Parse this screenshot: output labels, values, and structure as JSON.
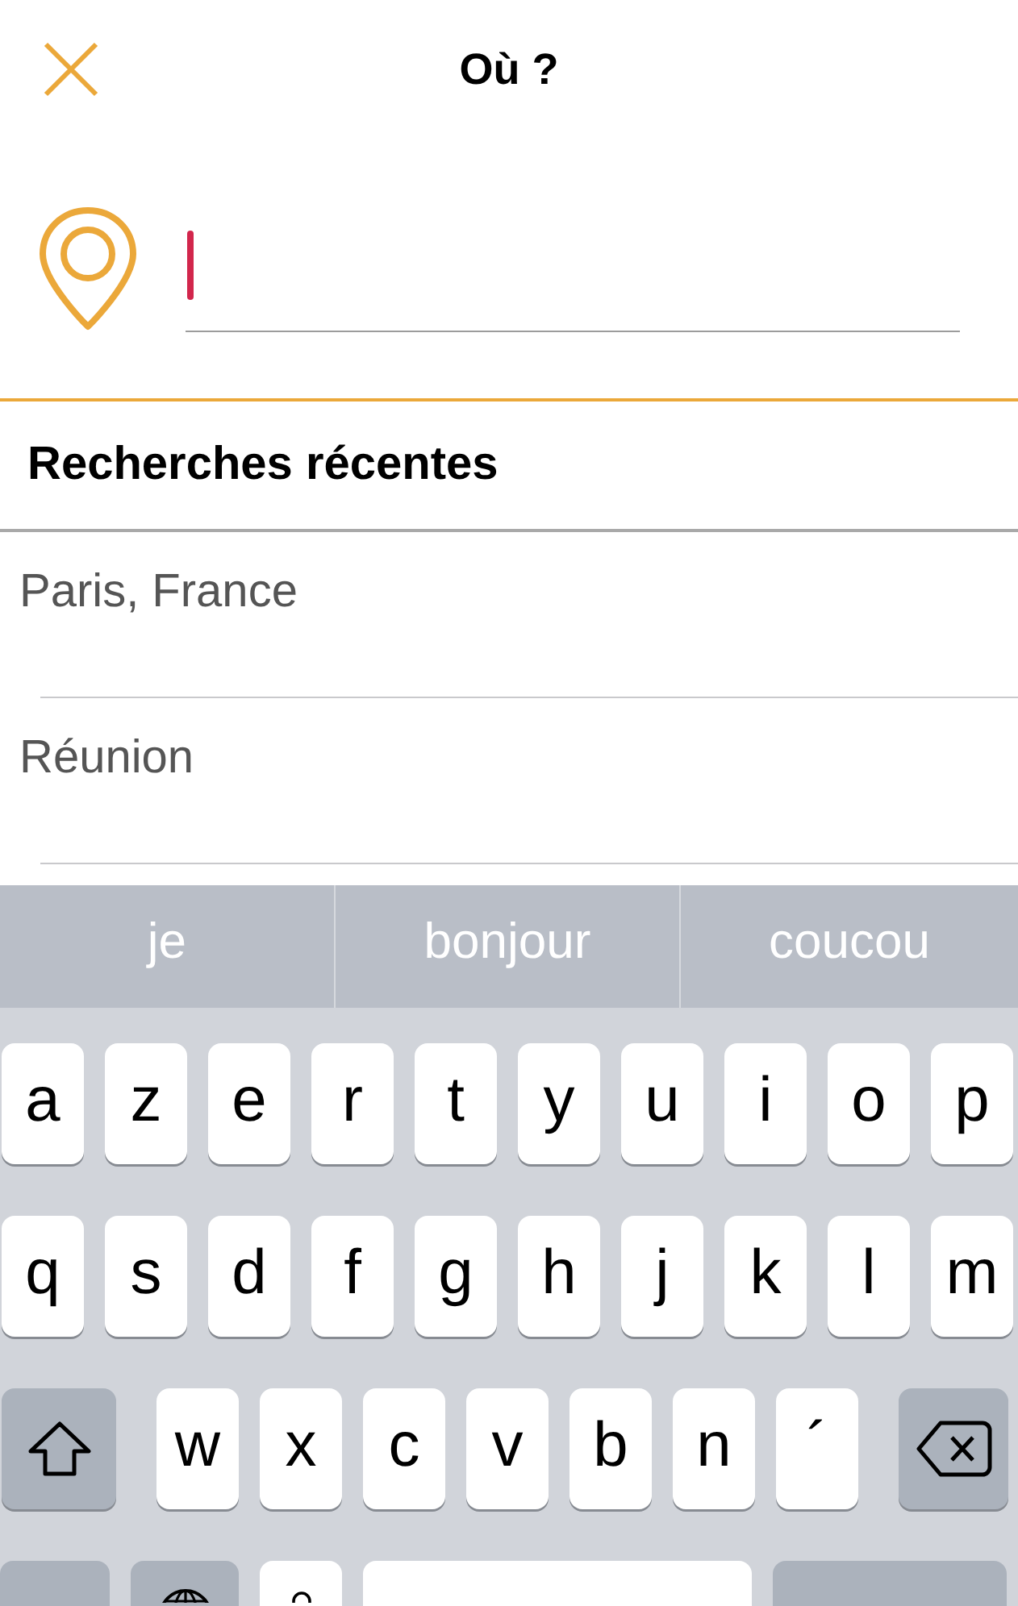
{
  "header": {
    "title": "Où ?"
  },
  "search": {
    "focused": true
  },
  "recent": {
    "heading": "Recherches récentes",
    "items": [
      "Paris, France",
      "Réunion"
    ]
  },
  "keyboard": {
    "suggestions": [
      "je",
      "bonjour",
      "coucou"
    ],
    "rows": [
      [
        {
          "kind": "letter",
          "label": "a"
        },
        {
          "kind": "letter",
          "label": "z"
        },
        {
          "kind": "letter",
          "label": "e"
        },
        {
          "kind": "letter",
          "label": "r"
        },
        {
          "kind": "letter",
          "label": "t"
        },
        {
          "kind": "letter",
          "label": "y"
        },
        {
          "kind": "letter",
          "label": "u"
        },
        {
          "kind": "letter",
          "label": "i"
        },
        {
          "kind": "letter",
          "label": "o"
        },
        {
          "kind": "letter",
          "label": "p"
        }
      ],
      [
        {
          "kind": "letter",
          "label": "q"
        },
        {
          "kind": "letter",
          "label": "s"
        },
        {
          "kind": "letter",
          "label": "d"
        },
        {
          "kind": "letter",
          "label": "f"
        },
        {
          "kind": "letter",
          "label": "g"
        },
        {
          "kind": "letter",
          "label": "h"
        },
        {
          "kind": "letter",
          "label": "j"
        },
        {
          "kind": "letter",
          "label": "k"
        },
        {
          "kind": "letter",
          "label": "l"
        },
        {
          "kind": "letter",
          "label": "m"
        }
      ],
      [
        {
          "kind": "shift"
        },
        {
          "kind": "letter",
          "label": "w"
        },
        {
          "kind": "letter",
          "label": "x"
        },
        {
          "kind": "letter",
          "label": "c"
        },
        {
          "kind": "letter",
          "label": "v"
        },
        {
          "kind": "letter",
          "label": "b"
        },
        {
          "kind": "letter",
          "label": "n"
        },
        {
          "kind": "letter",
          "label": "´"
        },
        {
          "kind": "delete"
        }
      ],
      [
        {
          "kind": "modifier"
        },
        {
          "kind": "globe"
        },
        {
          "kind": "mic"
        },
        {
          "kind": "space"
        },
        {
          "kind": "action"
        }
      ]
    ]
  }
}
